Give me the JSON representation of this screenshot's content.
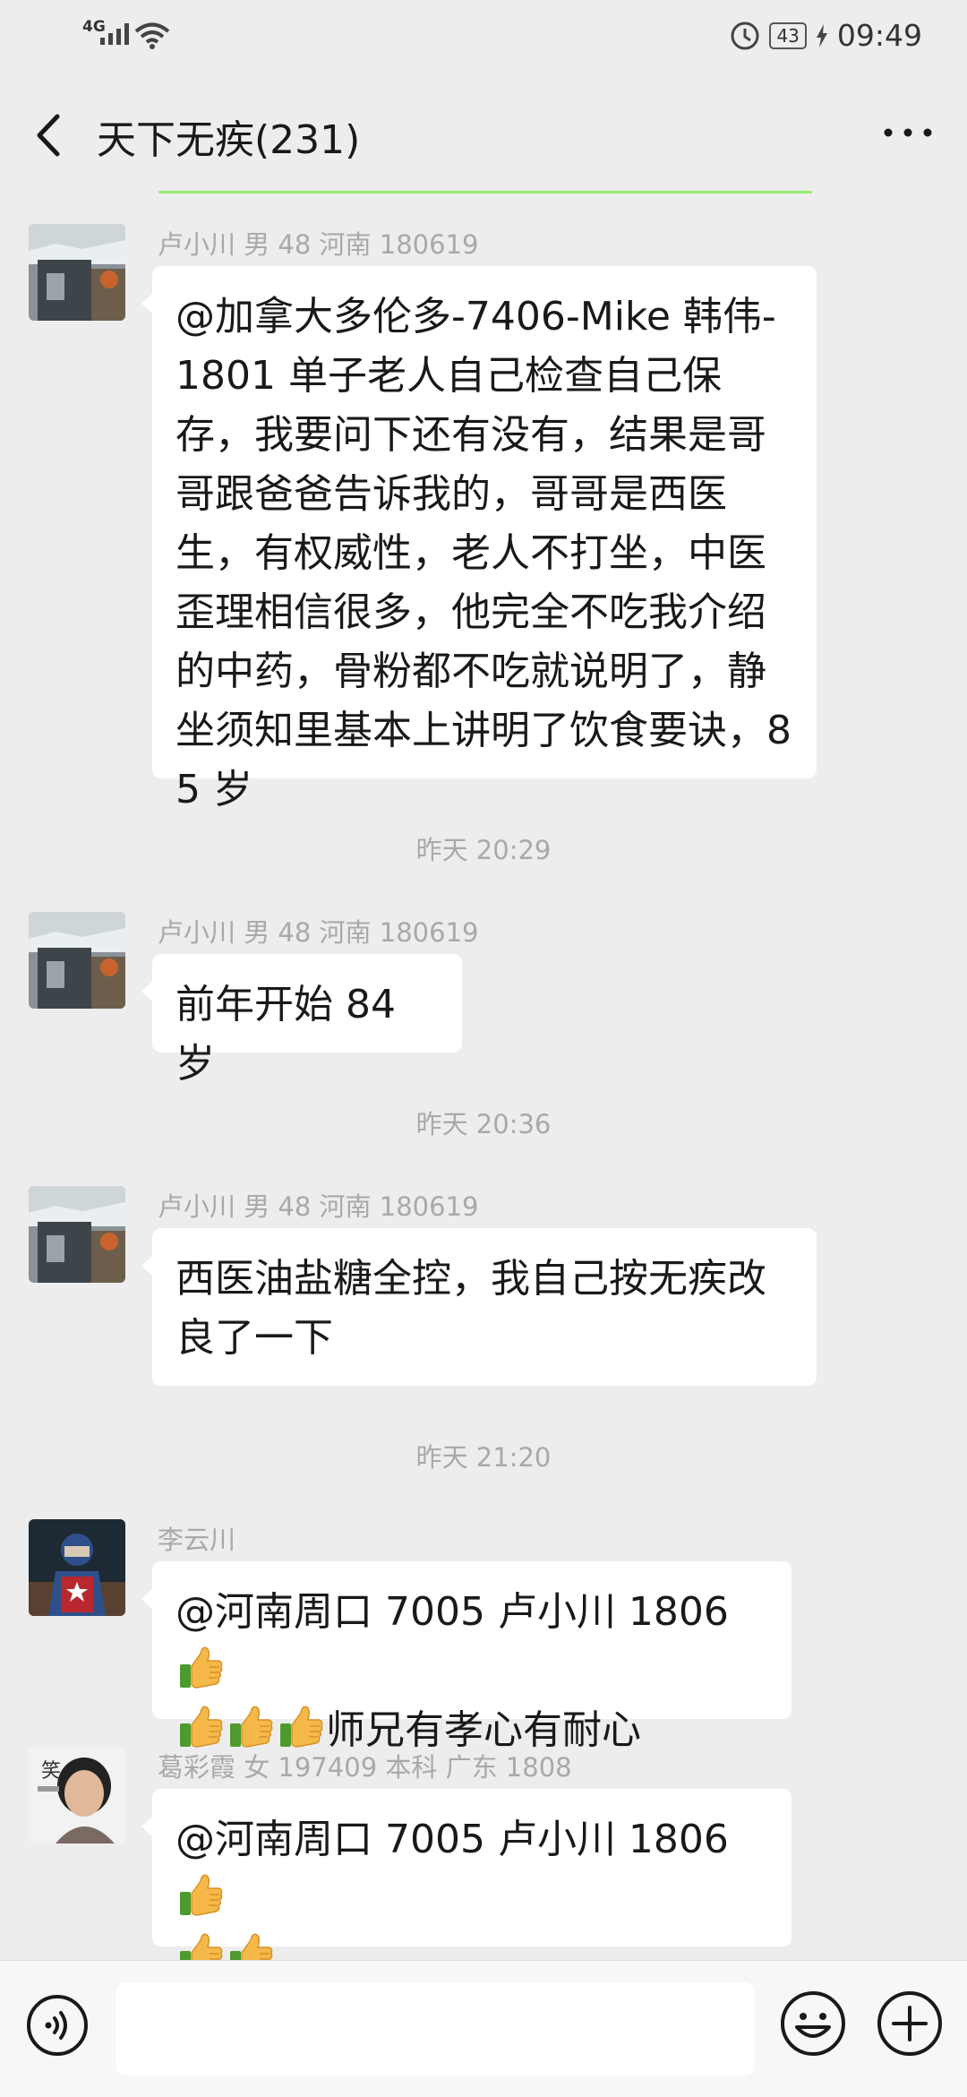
{
  "status_bar": {
    "network": "4G",
    "time": "09:49",
    "battery": "43"
  },
  "header": {
    "title": "天下无疾(231)"
  },
  "messages": [
    {
      "sender": "卢小川 男 48 河南 180619",
      "text": "@加拿大多伦多-7406-Mike 韩伟-1801  单子老人自己检查自己保存，我要问下还有没有，结果是哥哥跟爸爸告诉我的，哥哥是西医生，有权威性，老人不打坐，中医歪理相信很多，他完全不吃我介绍的中药，骨粉都不吃就说明了，静坐须知里基本上讲明了饮食要诀，85 岁"
    },
    {
      "timestamp": "昨天 20:29",
      "sender": "卢小川 男 48 河南 180619",
      "text": "前年开始 84 岁"
    },
    {
      "timestamp": "昨天 20:36",
      "sender": "卢小川 男 48 河南 180619",
      "text": "西医油盐糖全控，我自己按无疾改良了一下"
    },
    {
      "timestamp": "昨天 21:20",
      "sender": "李云川",
      "text_before": "@河南周口 7005 卢小川 1806 ",
      "text_after": "师兄有孝心有耐心"
    },
    {
      "sender": "葛彩霞 女 197409 本科 广东 1808",
      "text": "@河南周口 7005 卢小川 1806 "
    }
  ],
  "icons": {
    "back": "chevron-left-icon",
    "more": "more-dots-icon",
    "voice": "voice-icon",
    "emoji": "emoji-icon",
    "plus": "plus-icon",
    "thumbs_up": "thumbs-up-emoji"
  },
  "colors": {
    "background": "#ededed",
    "bubble": "#ffffff",
    "accent_line": "#95ec69",
    "meta_text": "#a9a9a9"
  }
}
